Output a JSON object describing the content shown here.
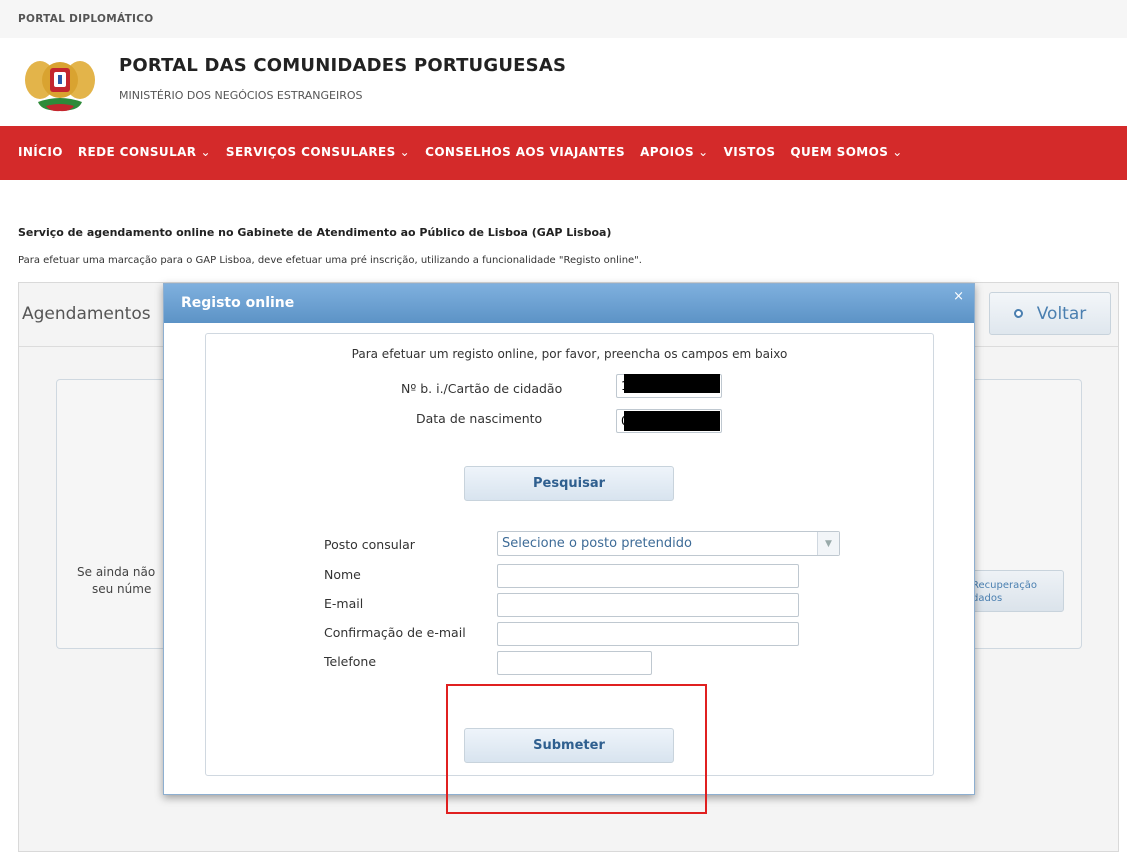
{
  "topbar": {
    "label": "PORTAL DIPLOMÁTICO"
  },
  "header": {
    "title": "PORTAL DAS COMUNIDADES PORTUGUESAS",
    "subtitle": "MINISTÉRIO DOS NEGÓCIOS ESTRANGEIROS",
    "logo_icon": "coat-of-arms-icon"
  },
  "nav": {
    "items": [
      {
        "label": "INÍCIO",
        "dropdown": false
      },
      {
        "label": "REDE CONSULAR",
        "dropdown": true
      },
      {
        "label": "SERVIÇOS CONSULARES",
        "dropdown": true
      },
      {
        "label": "CONSELHOS AOS VIAJANTES",
        "dropdown": false
      },
      {
        "label": "APOIOS",
        "dropdown": true
      },
      {
        "label": "VISTOS",
        "dropdown": false
      },
      {
        "label": "QUEM SOMOS",
        "dropdown": true
      }
    ],
    "caret": "⌄",
    "color": "#d42a2a"
  },
  "page": {
    "heading": "Serviço de agendamento online no Gabinete de Atendimento ao Público de Lisboa (GAP Lisboa)",
    "description": "Para efetuar uma marcação para o GAP Lisboa, deve efetuar uma pré inscrição, utilizando a funcionalidade \"Registo online\"."
  },
  "panel": {
    "title": "Agendamentos",
    "back_label": "Voltar",
    "inner_text_line1": "Se ainda não",
    "inner_text_line2": "seu núme",
    "recovery_label_line1": "Recuperação",
    "recovery_label_line2": "dados"
  },
  "modal": {
    "title": "Registo online",
    "close": "×",
    "instruction": "Para efetuar um registo online, por favor, preencha os campos em baixo",
    "id_label": "Nº b. i./Cartão de cidadão",
    "id_value": "1",
    "dob_label": "Data de nascimento",
    "dob_value": "0",
    "search_label": "Pesquisar",
    "post_label": "Posto consular",
    "post_selected": "Selecione o posto pretendido",
    "name_label": "Nome",
    "email_label": "E-mail",
    "email_confirm_label": "Confirmação de e-mail",
    "phone_label": "Telefone",
    "submit_label": "Submeter"
  },
  "colors": {
    "highlight": "#e02020",
    "modal_header": "#6aa0d2"
  }
}
